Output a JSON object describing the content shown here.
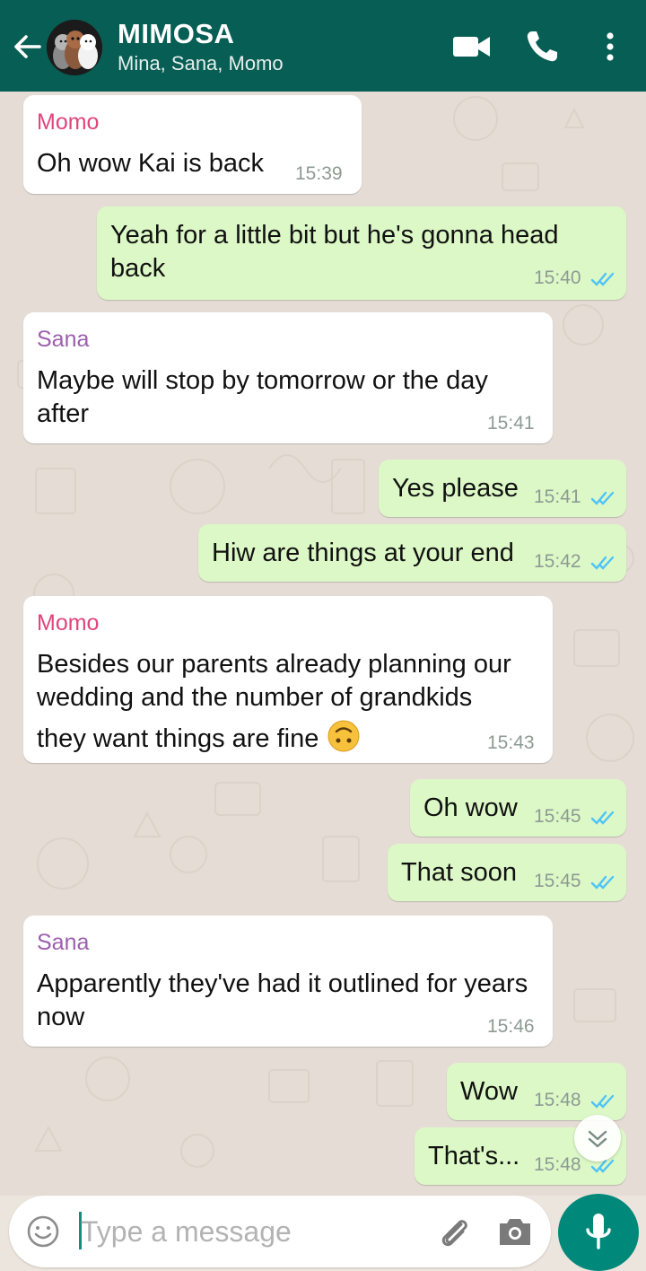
{
  "header": {
    "title": "MIMOSA",
    "subtitle": "Mina, Sana, Momo",
    "colors": {
      "bar": "#075e54"
    }
  },
  "messages": [
    {
      "dir": "in",
      "sender": "Momo",
      "sender_color": "#e0457b",
      "lines": [
        "Oh wow Kai is back"
      ],
      "time": "15:39"
    },
    {
      "dir": "out",
      "lines": [
        "Yeah for a little bit but he's gonna head",
        "back"
      ],
      "time": "15:40",
      "status": "read"
    },
    {
      "dir": "in",
      "sender": "Sana",
      "sender_color": "#9c5fae",
      "lines": [
        "Maybe will stop by tomorrow or the day",
        "after"
      ],
      "time": "15:41"
    },
    {
      "dir": "out",
      "lines": [
        "Yes please"
      ],
      "time": "15:41",
      "status": "read"
    },
    {
      "dir": "out",
      "lines": [
        "Hiw are things at your end"
      ],
      "time": "15:42",
      "status": "read"
    },
    {
      "dir": "in",
      "sender": "Momo",
      "sender_color": "#e0457b",
      "lines": [
        "Besides our parents already planning our",
        "wedding and the number of grandkids",
        "they want things are fine"
      ],
      "emoji": "upside-down-face",
      "time": "15:43"
    },
    {
      "dir": "out",
      "lines": [
        "Oh wow"
      ],
      "time": "15:45",
      "status": "read"
    },
    {
      "dir": "out",
      "lines": [
        "That soon"
      ],
      "time": "15:45",
      "status": "read"
    },
    {
      "dir": "in",
      "sender": "Sana",
      "sender_color": "#9c5fae",
      "lines": [
        "Apparently they've had it outlined for years",
        "now"
      ],
      "time": "15:46"
    },
    {
      "dir": "out",
      "lines": [
        "Wow"
      ],
      "time": "15:48",
      "status": "read"
    },
    {
      "dir": "out",
      "lines": [
        "That's..."
      ],
      "time": "15:48",
      "status": "read"
    }
  ],
  "composer": {
    "placeholder": "Type a message"
  },
  "icons": {
    "back": "arrow-left-icon",
    "video": "video-call-icon",
    "call": "phone-icon",
    "menu": "more-vert-icon",
    "emoji": "emoji-icon",
    "attach": "paperclip-icon",
    "camera": "camera-icon",
    "mic": "mic-icon",
    "scroll": "chevron-double-down-icon",
    "read": "double-check-icon"
  },
  "colors": {
    "incoming": "#ffffff",
    "outgoing": "#dcf8c6",
    "read_tick": "#4fc3f7",
    "mic_button": "#00897b"
  }
}
